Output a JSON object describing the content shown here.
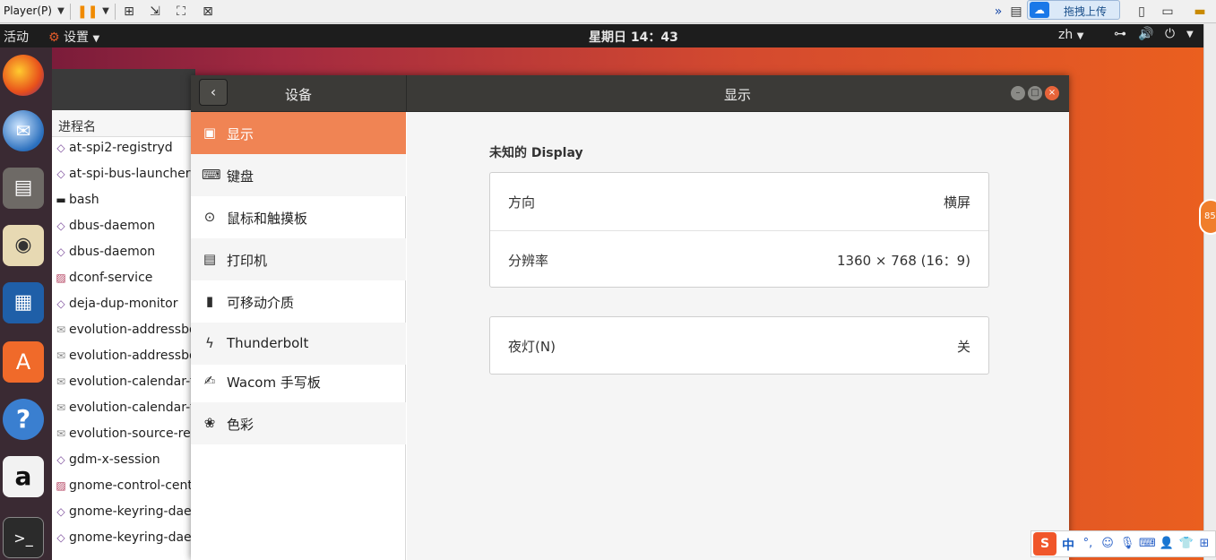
{
  "vm_toolbar": {
    "player_menu": "Player(P)",
    "upload_label": "拖拽上传"
  },
  "topbar": {
    "activities": "活动",
    "app_menu": "设置",
    "clock": "星期日 14：43",
    "lang": "zh"
  },
  "dock": {
    "items": [
      "firefox-icon",
      "thunderbird-icon",
      "files-icon",
      "rhythmbox-icon",
      "writer-icon",
      "software-center-icon",
      "help-icon",
      "amazon-icon",
      "terminal-icon"
    ]
  },
  "process_list": {
    "column_header": "进程名",
    "rows": [
      "at-spi2-registryd",
      "at-spi-bus-launcher",
      "bash",
      "dbus-daemon",
      "dbus-daemon",
      "dconf-service",
      "deja-dup-monitor",
      "evolution-addressbo",
      "evolution-addressbo",
      "evolution-calendar-f",
      "evolution-calendar-f",
      "evolution-source-reg",
      "gdm-x-session",
      "gnome-control-cente",
      "gnome-keyring-daem",
      "gnome-keyring-daem"
    ]
  },
  "settings": {
    "sidebar_title": "设备",
    "panel_title": "显示",
    "sidebar_items": [
      {
        "label": "显示",
        "icon": "display-icon"
      },
      {
        "label": "键盘",
        "icon": "keyboard-icon"
      },
      {
        "label": "鼠标和触摸板",
        "icon": "mouse-icon"
      },
      {
        "label": "打印机",
        "icon": "printer-icon"
      },
      {
        "label": "可移动介质",
        "icon": "removable-media-icon"
      },
      {
        "label": "Thunderbolt",
        "icon": "thunderbolt-icon"
      },
      {
        "label": "Wacom 手写板",
        "icon": "wacom-icon"
      },
      {
        "label": "色彩",
        "icon": "color-icon"
      }
    ],
    "active_index": 0,
    "display": {
      "heading": "未知的 Display",
      "orientation_label": "方向",
      "orientation_value": "横屏",
      "resolution_label": "分辨率",
      "resolution_value": "1360 × 768 (16：9)",
      "night_light_label": "夜灯(N)",
      "night_light_value": "关"
    }
  },
  "side_bubble": "85",
  "ime": {
    "logo": "S",
    "mode": "中"
  }
}
